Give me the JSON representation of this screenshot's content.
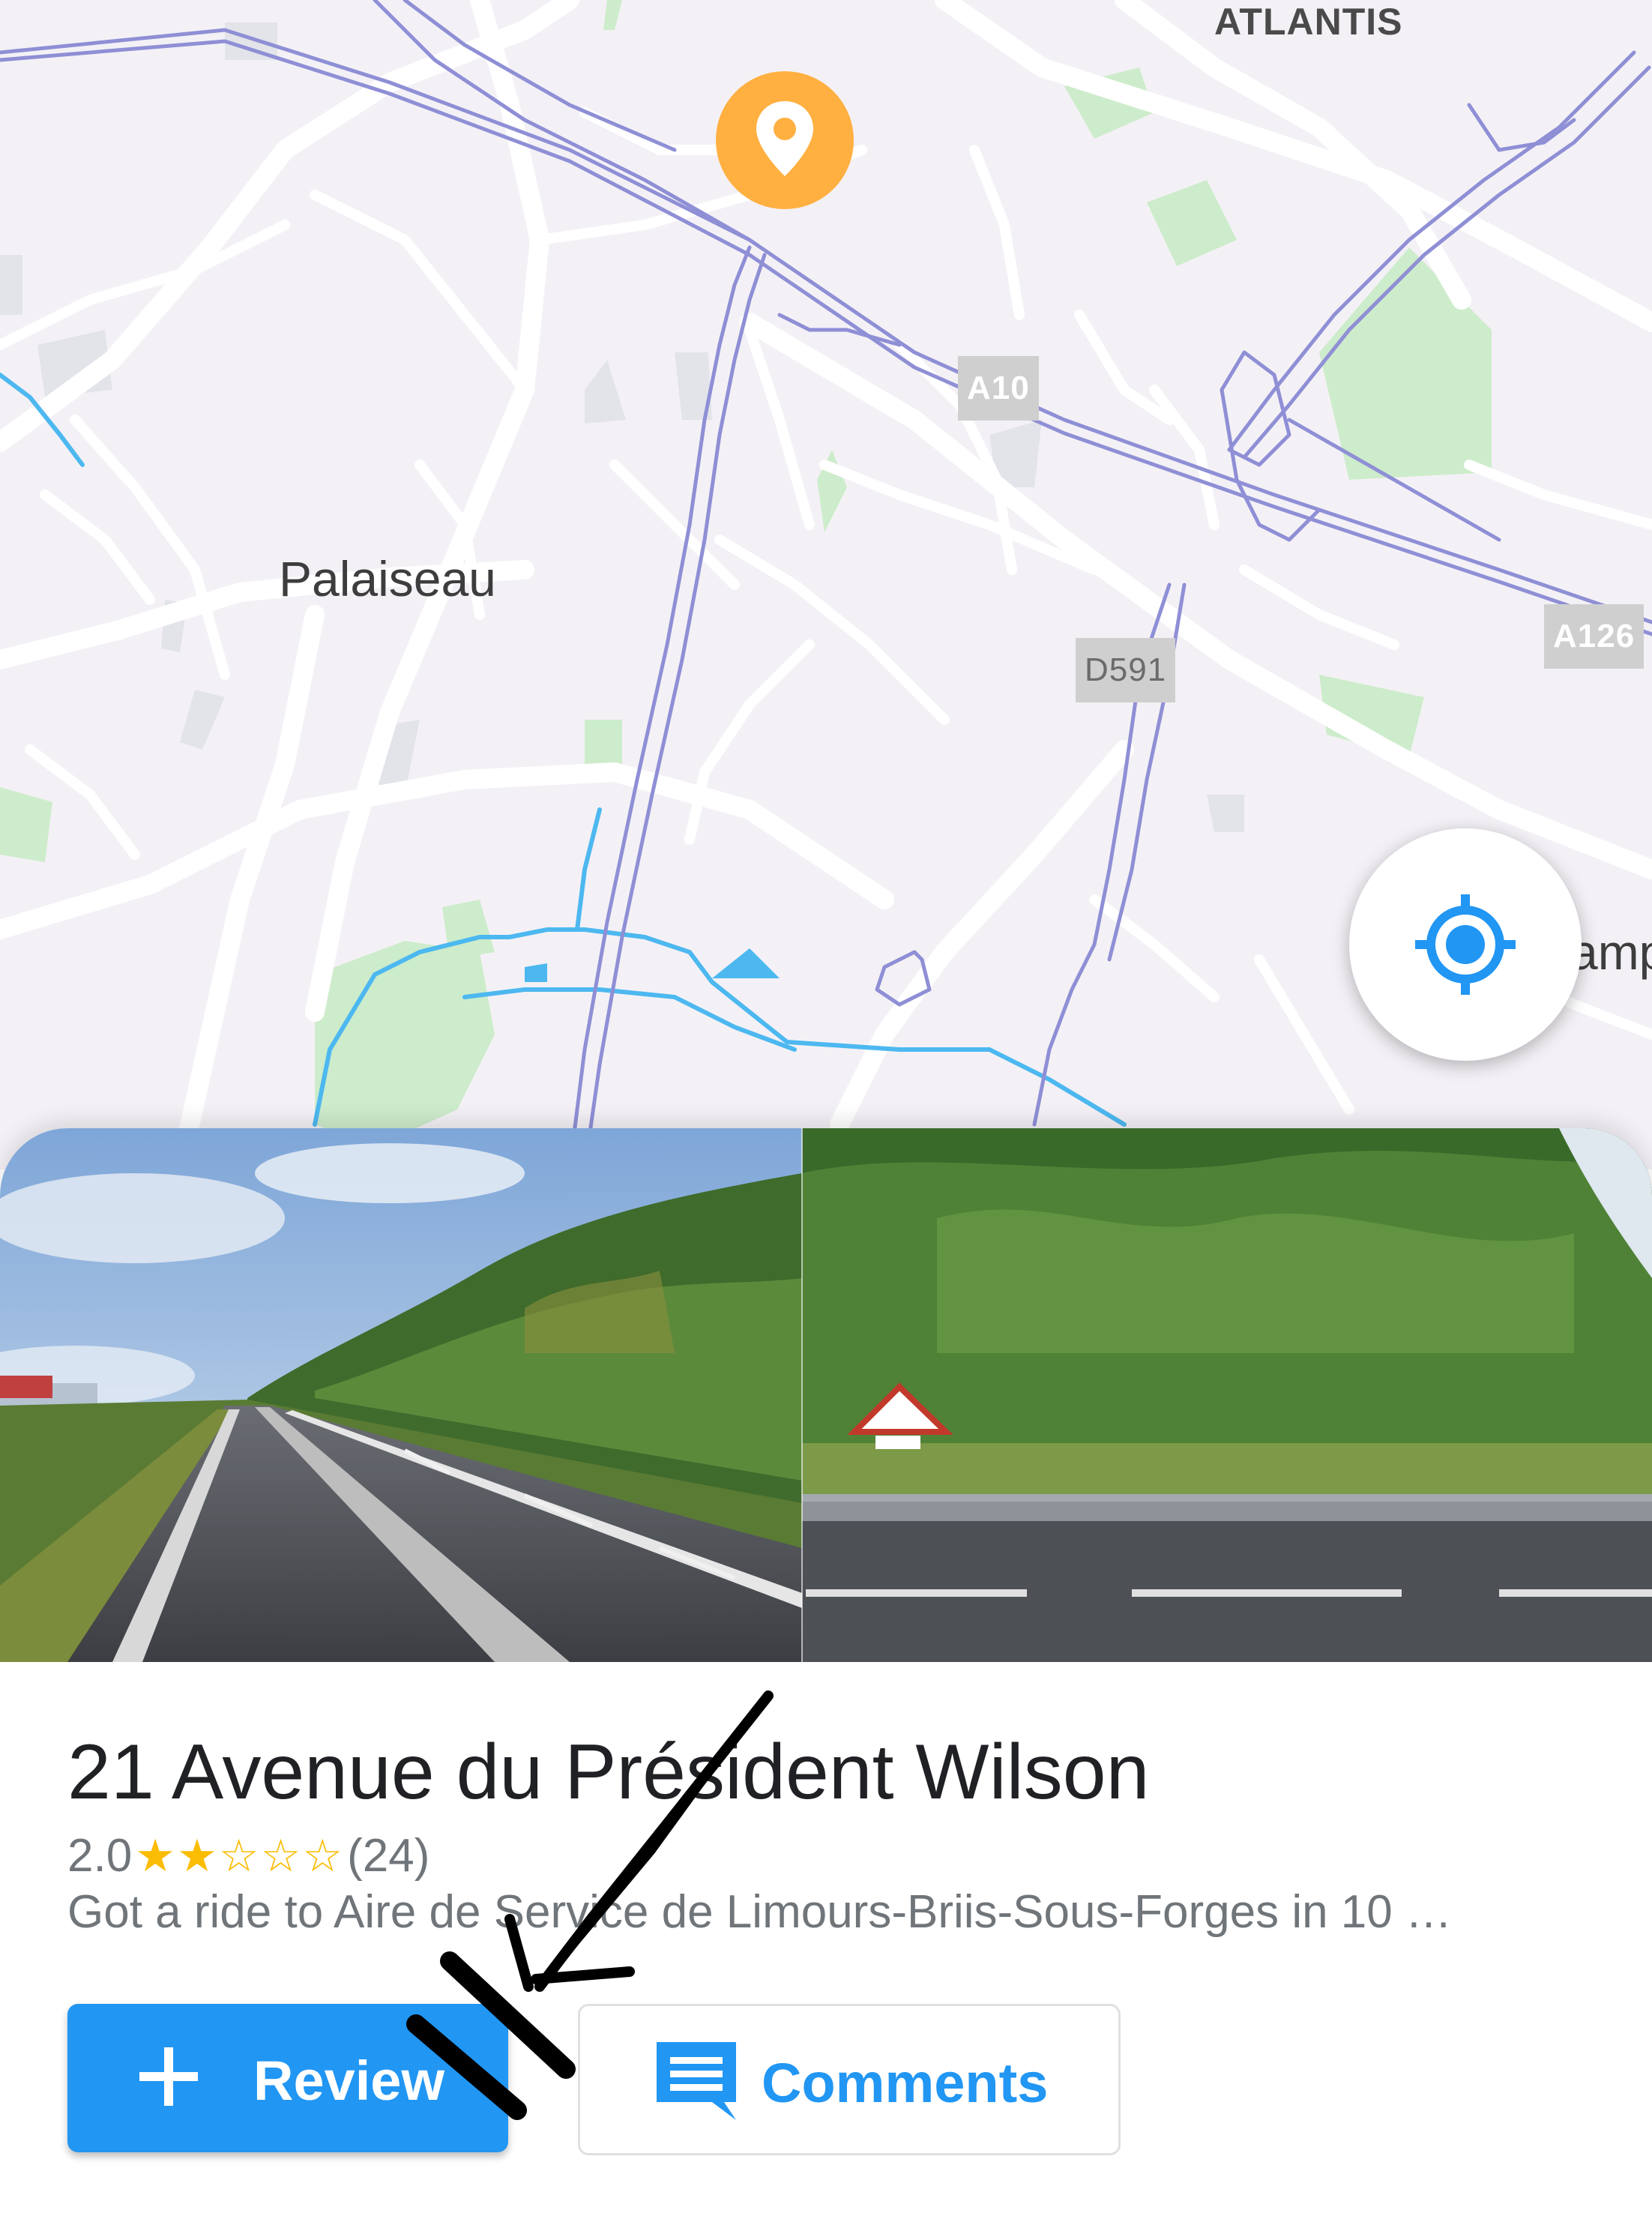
{
  "map": {
    "labels": {
      "atlantis": "ATLANTIS",
      "palaiseau": "Palaiseau",
      "champ_partial": "amp"
    },
    "road_shields": {
      "a10": "A10",
      "d591": "D591",
      "a126": "A126"
    },
    "colors": {
      "background": "#f4f1f6",
      "roads": "#ffffff",
      "highways": "#8f8fd6",
      "water": "#4db8f0",
      "parks": "#cdeccb",
      "pin": "#ffb041"
    },
    "pin_icon": "map-pin-icon",
    "location_button_icon": "my-location-icon"
  },
  "place": {
    "title": "21 Avenue du Président Wilson",
    "rating": "2.0",
    "stars": "★★☆☆☆",
    "stars_filled": 2,
    "stars_total": 5,
    "review_count": "(24)",
    "description": "Got a ride to Aire de Service de Limours-Briis-Sous-Forges in 10 …",
    "star_color": "#fbbc04"
  },
  "actions": {
    "review_label": "Review",
    "review_icon": "plus-icon",
    "comments_label": "Comments",
    "comments_icon": "comment-icon",
    "accent": "#2196f3"
  }
}
